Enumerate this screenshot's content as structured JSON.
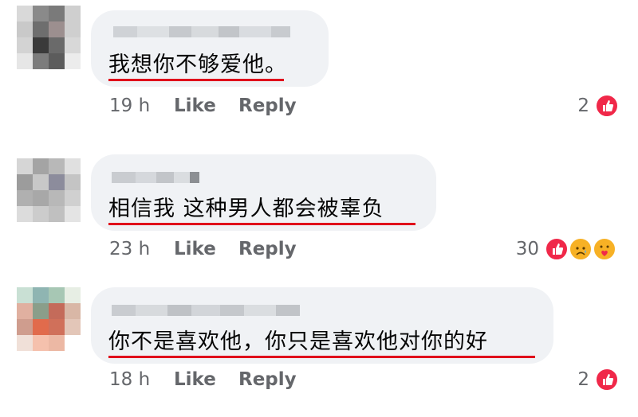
{
  "comments": [
    {
      "text": "我想你不够爱他。",
      "time": "19 h",
      "like": "Like",
      "reply": "Reply",
      "reaction_count": "2",
      "reactions": [
        "love-thumb-icon"
      ],
      "avatar_colors": [
        "#d9d9d9",
        "#8a8a8a",
        "#7a7a7a",
        "#cfcfcf",
        "#c9c9c9",
        "#6e6e6e",
        "#9c8f8f",
        "#cfcfcf",
        "#d3d3d3",
        "#3a3a3a",
        "#6a6a6a",
        "#d8d8d8",
        "#e6e6e6",
        "#7c7c7c",
        "#5c5c5c",
        "#ececec"
      ]
    },
    {
      "text": "相信我 这种男人都会被辜负",
      "time": "23 h",
      "like": "Like",
      "reply": "Reply",
      "reaction_count": "30",
      "reactions": [
        "love-thumb-icon",
        "sad-icon",
        "care-icon"
      ],
      "avatar_colors": [
        "#d6d6d6",
        "#a4a4a4",
        "#b8b8b8",
        "#e0e0e0",
        "#9c9c9c",
        "#c8c8c8",
        "#8c8c9c",
        "#c4c4c4",
        "#b0b0b0",
        "#a8a8a8",
        "#b8b8b8",
        "#d0d0d0",
        "#dcdcdc",
        "#cccccc",
        "#c0c0c0",
        "#e4e4e4"
      ]
    },
    {
      "text": "你不是喜欢他，你只是喜欢他对你的好",
      "time": "18 h",
      "like": "Like",
      "reply": "Reply",
      "reaction_count": "2",
      "reactions": [
        "love-thumb-icon"
      ],
      "avatar_colors": [
        "#c9e0d4",
        "#8fb5b2",
        "#a7c7b4",
        "#e7eee4",
        "#e0b0a0",
        "#8a9e8a",
        "#c46b5a",
        "#d9b7a6",
        "#cf9d8e",
        "#e16b4c",
        "#d0705a",
        "#e3c6b8",
        "#f0e0d8",
        "#f5c1ad",
        "#ecb8a4",
        "#ffffff"
      ]
    }
  ],
  "colors": {
    "bubble": "#f0f2f5",
    "underline": "#e0001b",
    "meta_text": "#65676b",
    "love": "#f02849"
  }
}
